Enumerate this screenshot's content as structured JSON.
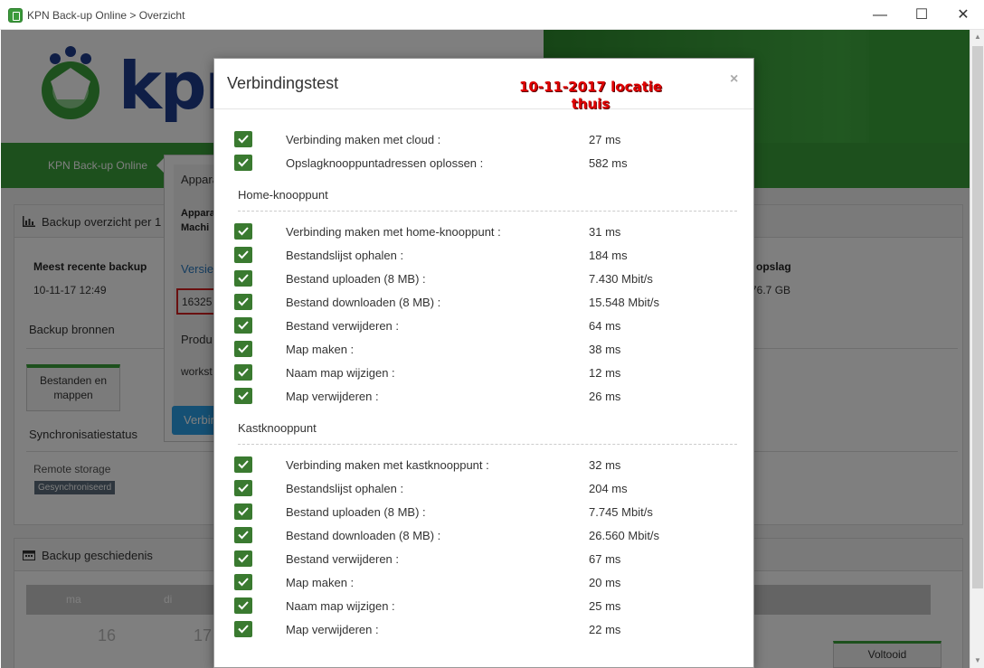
{
  "window": {
    "title": "KPN Back-up Online > Overzicht",
    "controls": {
      "minimize": "—",
      "maximize": "☐",
      "close": "✕"
    }
  },
  "background": {
    "logo_text": "kpn",
    "nav_item": "KPN Back-up Online",
    "overview_panel_title": "Backup overzicht per 1",
    "recent_backup_label": "Meest recente backup",
    "recent_backup_value": "10-11-17 12:49",
    "storage_label": "opslag",
    "storage_value": "76.7 GB",
    "sources_heading": "Backup bronnen",
    "source_button_line1": "Bestanden en",
    "source_button_line2": "mappen",
    "sync_heading": "Synchronisatiestatus",
    "remote_storage_label": "Remote storage",
    "sync_badge": "Gesynchroniseerd",
    "history_panel_title": "Backup geschiedenis",
    "calendar_days": [
      "ma",
      "di"
    ],
    "calendar_dates": [
      "16",
      "17"
    ],
    "done_button": "Voltooid",
    "popover": {
      "title": "Appara",
      "small1": "Appara",
      "small2": "Machi",
      "version_link": "Versie",
      "version_value": "16325",
      "product_label": "Produ",
      "product_value": "workst",
      "button": "Verbindingstest"
    }
  },
  "modal": {
    "title": "Verbindingstest",
    "close_icon": "×",
    "annotation_line1": "10-11-2017 locatie",
    "annotation_line2": "thuis",
    "cloud_rows": [
      {
        "name": "Verbinding maken met cloud :",
        "value": "27 ms"
      },
      {
        "name": "Opslagknooppuntadressen oplossen :",
        "value": "582 ms"
      }
    ],
    "home_title": "Home-knooppunt",
    "home_rows": [
      {
        "name": "Verbinding maken met home-knooppunt :",
        "value": "31 ms"
      },
      {
        "name": "Bestandslijst ophalen :",
        "value": "184 ms"
      },
      {
        "name": "Bestand uploaden (8 MB) :",
        "value": "7.430 Mbit/s"
      },
      {
        "name": "Bestand downloaden (8 MB) :",
        "value": "15.548 Mbit/s"
      },
      {
        "name": "Bestand verwijderen :",
        "value": "64 ms"
      },
      {
        "name": "Map maken :",
        "value": "38 ms"
      },
      {
        "name": "Naam map wijzigen :",
        "value": "12 ms"
      },
      {
        "name": "Map verwijderen :",
        "value": "26 ms"
      }
    ],
    "vault_title": "Kastknooppunt",
    "vault_rows": [
      {
        "name": "Verbinding maken met kastknooppunt :",
        "value": "32 ms"
      },
      {
        "name": "Bestandslijst ophalen :",
        "value": "204 ms"
      },
      {
        "name": "Bestand uploaden (8 MB) :",
        "value": "7.745 Mbit/s"
      },
      {
        "name": "Bestand downloaden (8 MB) :",
        "value": "26.560 Mbit/s"
      },
      {
        "name": "Bestand verwijderen :",
        "value": "67 ms"
      },
      {
        "name": "Map maken :",
        "value": "20 ms"
      },
      {
        "name": "Naam map wijzigen :",
        "value": "25 ms"
      },
      {
        "name": "Map verwijderen :",
        "value": "22 ms"
      }
    ]
  }
}
